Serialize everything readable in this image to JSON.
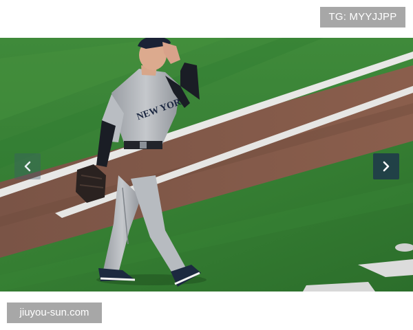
{
  "top_badge": {
    "text": "TG: MYYJJPP"
  },
  "slideshow": {
    "image_alt": "Baseball pitcher in grey road uniform walking off the field",
    "jersey_text": "NEW YORK",
    "prev_icon": "chevron-left-icon",
    "next_icon": "chevron-right-icon"
  },
  "bottom_badge": {
    "text": "jiuyou-sun.com"
  }
}
